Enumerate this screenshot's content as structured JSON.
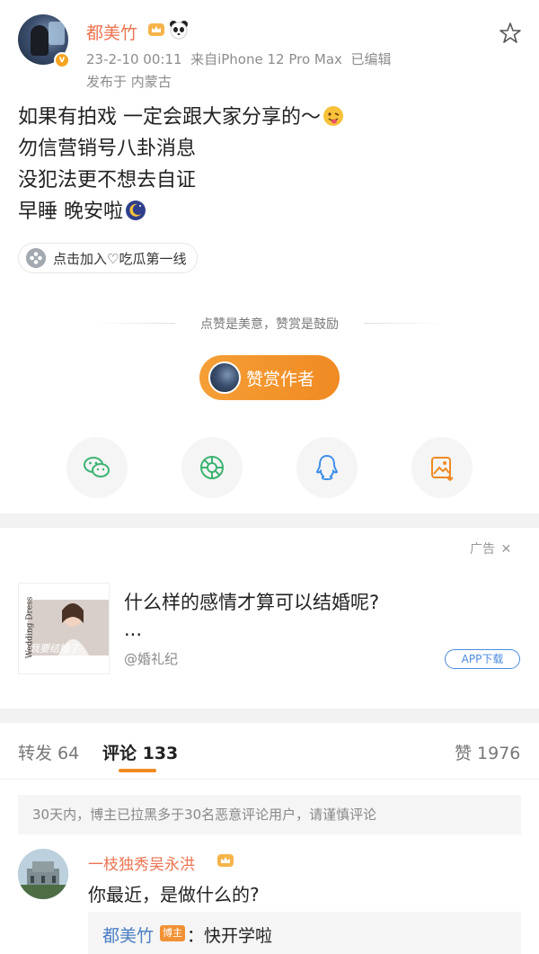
{
  "post": {
    "username": "都美竹",
    "time_source": "23-2-10 00:11  来自iPhone 12 Pro Max  已编辑",
    "location": "发布于 内蒙古",
    "content_lines": [
      "如果有拍戏 一定会跟大家分享的～",
      "勿信营销号八卦消息",
      "没犯法更不想去自证",
      "早睡 晚安啦"
    ],
    "topic": "点击加入♡吃瓜第一线"
  },
  "reward": {
    "prompt": "点赞是美意，赞赏是鼓励",
    "button_label": "赞赏作者"
  },
  "share": {
    "icons": [
      "wechat-icon",
      "moments-icon",
      "qq-icon",
      "save-image-icon"
    ]
  },
  "ad": {
    "label": "广告",
    "title": "什么样的感情才算可以结婚呢?",
    "ellipsis": "...",
    "source": "@婚礼纪",
    "app_button": "APP下载",
    "thumb_caption": "我要结婚了",
    "thumb_side": "Wedding Dress"
  },
  "tabs": {
    "repost": "转发 64",
    "comments": "评论 133",
    "likes": "赞 1976"
  },
  "notice": "30天内，博主已拉黑多于30名恶意评论用户，请谨慎评论",
  "comment": {
    "username": "一枝独秀吴永洪",
    "text": "你最近，是做什么的?",
    "reply_user": "都美竹",
    "reply_badge": "博主",
    "reply_text": "：快开学啦"
  },
  "colors": {
    "username": "#eb7350",
    "accent": "#f08a23",
    "link": "#4b7dc4"
  }
}
